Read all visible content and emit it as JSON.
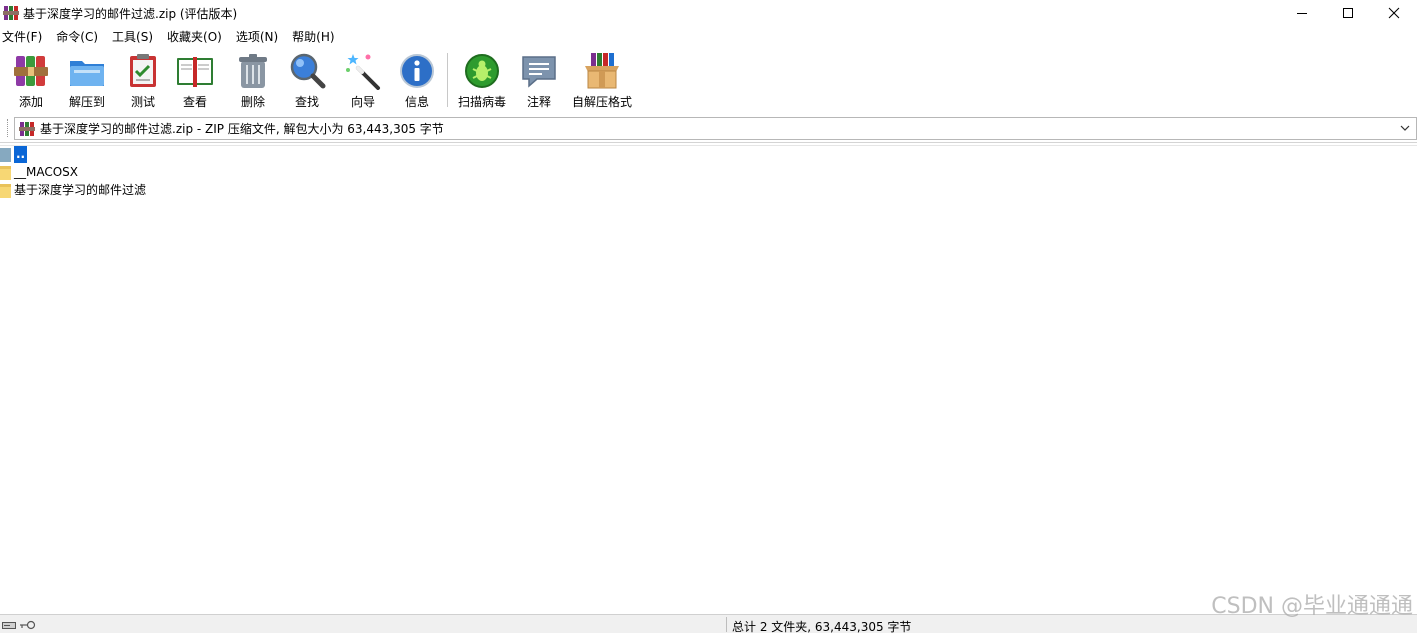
{
  "window": {
    "title": "基于深度学习的邮件过滤.zip (评估版本)",
    "controls": {
      "minimize_icon": "minimize-icon",
      "maximize_icon": "maximize-icon",
      "close_icon": "close-icon"
    }
  },
  "menu": [
    {
      "label": "文件(F)"
    },
    {
      "label": "命令(C)"
    },
    {
      "label": "工具(S)"
    },
    {
      "label": "收藏夹(O)"
    },
    {
      "label": "选项(N)"
    },
    {
      "label": "帮助(H)"
    }
  ],
  "toolbar": {
    "add": "添加",
    "extract_to": "解压到",
    "test": "测试",
    "view": "查看",
    "delete": "删除",
    "find": "查找",
    "wizard": "向导",
    "info": "信息",
    "virus_scan": "扫描病毒",
    "comment": "注释",
    "sfx": "自解压格式"
  },
  "address": {
    "text": "基于深度学习的邮件过滤.zip - ZIP 压缩文件, 解包大小为 63,443,305 字节"
  },
  "files": [
    {
      "name": "..",
      "kind": "parent"
    },
    {
      "name": "__MACOSX",
      "kind": "folder"
    },
    {
      "name": "基于深度学习的邮件过滤",
      "kind": "folder"
    }
  ],
  "status": {
    "summary": "总计 2 文件夹, 63,443,305 字节"
  },
  "watermark": "CSDN @毕业通通通",
  "colors": {
    "selection": "#0a66d6",
    "folder": "#f7d774"
  }
}
